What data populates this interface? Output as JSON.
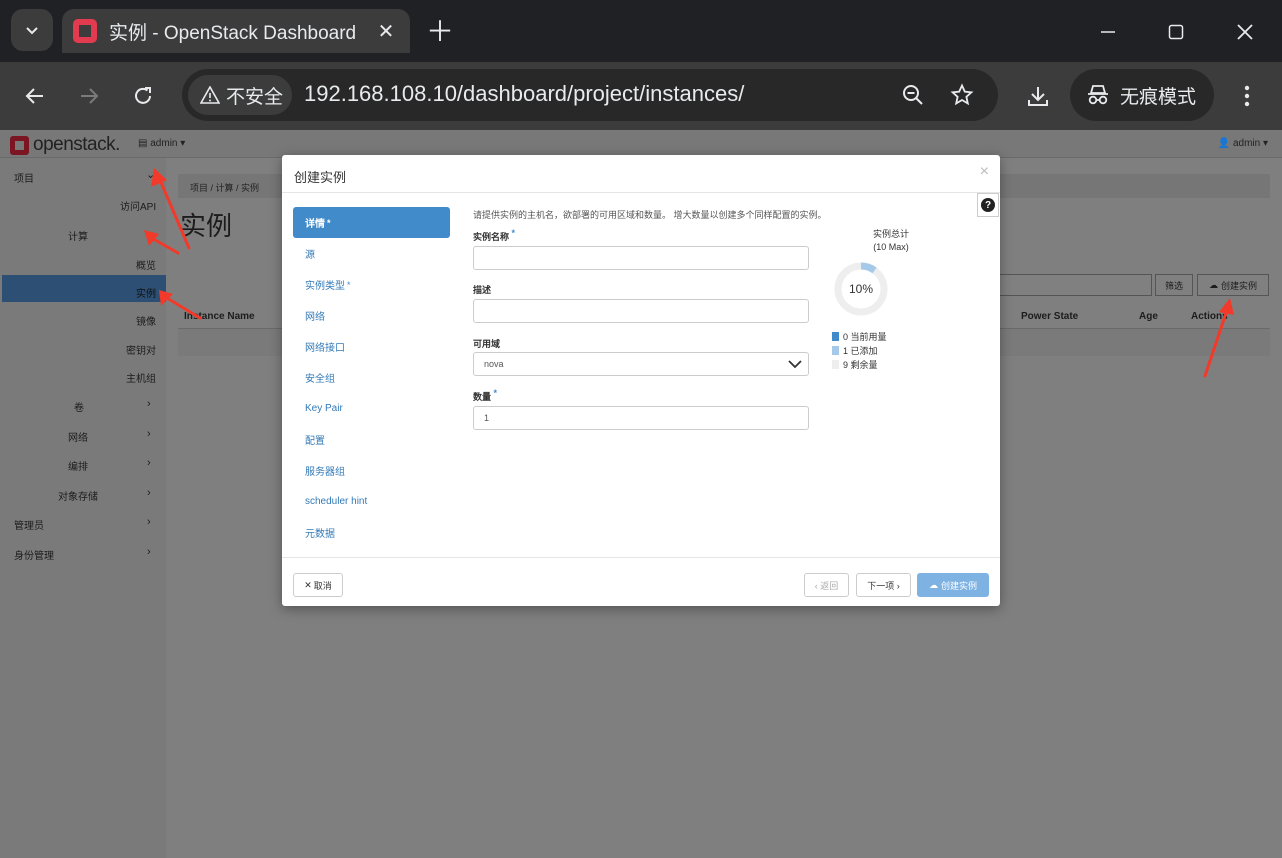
{
  "browser": {
    "tab_title": "实例 - OpenStack Dashboard",
    "security_label": "不安全",
    "url": "192.168.108.10/dashboard/project/instances/",
    "incognito_label": "无痕模式"
  },
  "navbar": {
    "logo_text": "openstack.",
    "project": "admin ▾",
    "user": "admin ▾"
  },
  "sidebar": {
    "project": "项目",
    "api_access": "访问API",
    "compute": "计算",
    "overview": "概览",
    "instances": "实例",
    "images": "镜像",
    "key_pairs": "密钥对",
    "server_groups": "主机组",
    "volumes": "卷",
    "network": "网络",
    "orchestration": "编排",
    "object_store": "对象存储",
    "admin": "管理员",
    "identity": "身份管理"
  },
  "main": {
    "breadcrumb": "项目 /  计算 /  实例",
    "title": "实例",
    "filter_label": "筛选",
    "create_label": "创建实例",
    "columns": {
      "instance_name": "Instance Name",
      "power_state": "Power State",
      "age": "Age",
      "actions": "Actions"
    }
  },
  "modal": {
    "title": "创建实例",
    "close": "×",
    "help": "?",
    "steps": [
      {
        "label": "详情",
        "required": "*"
      },
      {
        "label": "源",
        "required": ""
      },
      {
        "label": "实例类型",
        "required": "*"
      },
      {
        "label": "网络",
        "required": ""
      },
      {
        "label": "网络接口",
        "required": ""
      },
      {
        "label": "安全组",
        "required": ""
      },
      {
        "label": "Key Pair",
        "required": ""
      },
      {
        "label": "配置",
        "required": ""
      },
      {
        "label": "服务器组",
        "required": ""
      },
      {
        "label": "scheduler hint",
        "required": ""
      },
      {
        "label": "元数据",
        "required": ""
      }
    ],
    "intro": "请提供实例的主机名，欲部署的可用区域和数量。 增大数量以创建多个同样配置的实例。",
    "fields": {
      "name_label": "实例名称",
      "name_value": "",
      "desc_label": "描述",
      "desc_value": "",
      "az_label": "可用域",
      "az_value": "nova",
      "count_label": "数量",
      "count_value": "1",
      "required_mark": "*"
    },
    "quota": {
      "title": "实例总计",
      "subtitle": "(10 Max)",
      "percent_label": "10%",
      "used_fraction": 0.1,
      "legend": [
        {
          "label": "0  当前用量",
          "color": "#428bca"
        },
        {
          "label": "1  已添加",
          "color": "#a5c9e8"
        },
        {
          "label": "9  剩余量",
          "color": "#eeeeee"
        }
      ]
    },
    "footer": {
      "cancel": "取消",
      "back": "‹ 返回",
      "next": "下一项 ›",
      "launch": "创建实例"
    }
  },
  "colors": {
    "accent": "#428bca",
    "annotation": "#f23a2a"
  }
}
